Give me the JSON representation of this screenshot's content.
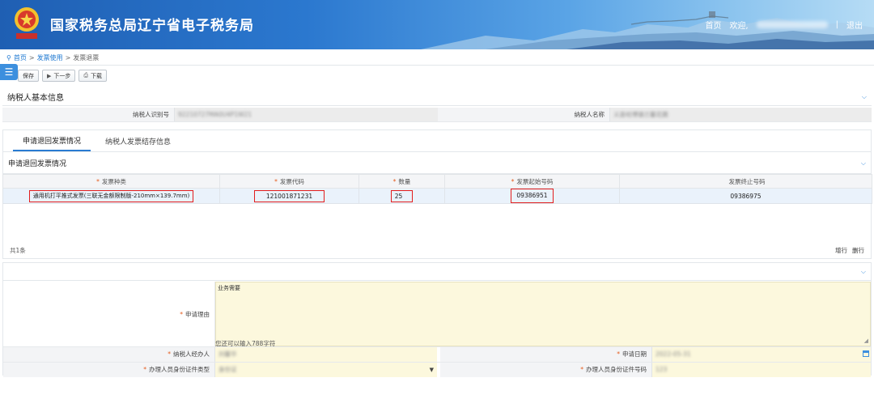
{
  "header": {
    "site_title": "国家税务总局辽宁省电子税务局",
    "home_link": "首页",
    "welcome": "欢迎,",
    "separator": "|",
    "logout": "退出"
  },
  "breadcrumb": {
    "home": "首页",
    "sep": ">",
    "level1": "发票使用",
    "current": "发票退票"
  },
  "toolbar": {
    "save": "保存",
    "next": "下一步",
    "download": "下载"
  },
  "taxpayer_panel": {
    "title": "纳税人基本信息",
    "id_label": "纳税人识别号",
    "id_value": "92210727MA0U4P1W21",
    "name_label": "纳税人名称",
    "name_value": "义县哈博镇兰馨花圃"
  },
  "tabs": [
    {
      "label": "申请退回发票情况",
      "active": true
    },
    {
      "label": "纳税人发票结存信息",
      "active": false
    }
  ],
  "invoice_section": {
    "title": "申请退回发票情况",
    "columns": [
      {
        "label": "发票种类",
        "required": "*"
      },
      {
        "label": "发票代码",
        "required": "*"
      },
      {
        "label": "数量",
        "required": "*"
      },
      {
        "label": "发票起始号码",
        "required": "*"
      },
      {
        "label": "发票终止号码",
        "required": ""
      }
    ],
    "rows": [
      {
        "type": "通用机打平推式发票(三联无金额限制版-210mm×139.7mm)",
        "code": "121001871231",
        "quantity": "25",
        "start_no": "09386951",
        "end_no": "09386975"
      }
    ],
    "count": "共1条",
    "add_row": "增行",
    "del_row": "删行"
  },
  "reason_form": {
    "reason_required": "*",
    "reason_label": "申请理由",
    "reason_value": "业务需要",
    "char_hint": "您还可以输入788字符",
    "agent_label": "纳税人经办人",
    "agent_value": "刘馨华",
    "date_label": "申请日期",
    "date_value": "2022-05-31",
    "idtype_label": "办理人员身份证件类型",
    "idtype_value": "身份证",
    "idno_label": "办理人员身份证件号码",
    "idno_value": "123"
  }
}
